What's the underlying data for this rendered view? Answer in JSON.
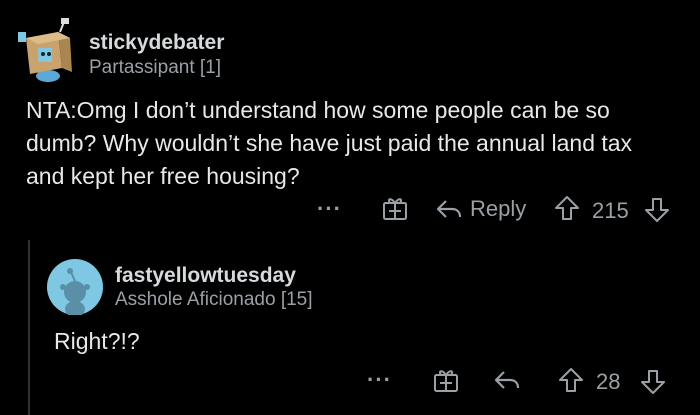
{
  "comments": [
    {
      "username": "stickydebater",
      "flair": "Partassipant [1]",
      "body": "NTA:Omg I don’t understand how some people can be so dumb? Why wouldn’t she have just paid the annual land tax and kept her free housing?",
      "reply_label": "Reply",
      "score": "215",
      "icons": {
        "avatar": "box-head-robot-avatar",
        "more": "more-dots-icon",
        "award": "gift-award-icon",
        "reply": "reply-arrow-icon",
        "upvote": "upvote-arrow-icon",
        "downvote": "downvote-arrow-icon"
      }
    },
    {
      "username": "fastyellowtuesday",
      "flair": "Asshole Aficionado [15]",
      "body": "Right?!?",
      "score": "28",
      "icons": {
        "avatar": "default-snoo-avatar",
        "more": "more-dots-icon",
        "award": "gift-award-icon",
        "reply": "reply-arrow-icon",
        "upvote": "upvote-arrow-icon",
        "downvote": "downvote-arrow-icon"
      }
    }
  ],
  "colors": {
    "background": "#000000",
    "text": "#e6e8ea",
    "muted": "#9aa0a6",
    "avatar_blue": "#7ec8e3"
  }
}
